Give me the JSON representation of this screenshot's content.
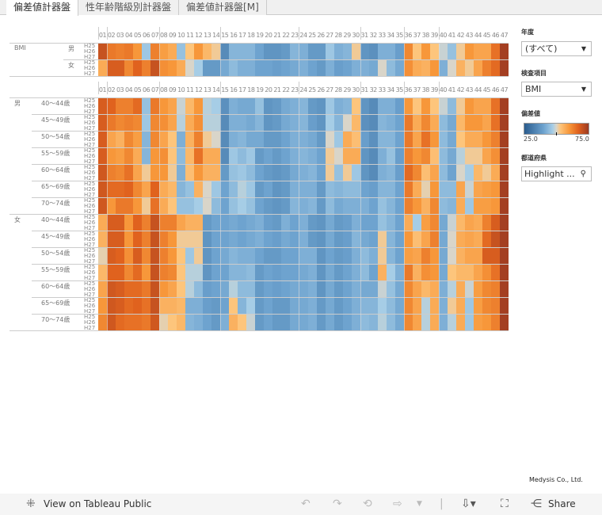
{
  "tabs": [
    "偏差値計器盤",
    "性年齢階級別計器盤",
    "偏差値計器盤[M]"
  ],
  "columns": [
    "01",
    "02",
    "03",
    "04",
    "05",
    "06",
    "07",
    "08",
    "09",
    "10",
    "11",
    "12",
    "13",
    "14",
    "15",
    "16",
    "17",
    "18",
    "19",
    "20",
    "21",
    "22",
    "23",
    "24",
    "25",
    "26",
    "27",
    "28",
    "29",
    "30",
    "31",
    "32",
    "33",
    "34",
    "35",
    "36",
    "37",
    "38",
    "39",
    "40",
    "41",
    "42",
    "43",
    "44",
    "45",
    "46",
    "47"
  ],
  "years": [
    "H25",
    "H26",
    "H27"
  ],
  "top_section": {
    "item": "BMI",
    "groups": [
      {
        "sex": "男",
        "values": [
          70,
          64,
          63,
          64,
          60,
          46,
          63,
          59,
          57,
          45,
          53,
          60,
          55,
          52,
          35,
          43,
          43,
          43,
          40,
          37,
          37,
          38,
          43,
          42,
          38,
          38,
          46,
          42,
          43,
          52,
          37,
          36,
          42,
          42,
          39,
          62,
          53,
          60,
          53,
          49,
          45,
          52,
          60,
          58,
          58,
          65,
          74
        ]
      },
      {
        "sex": "女",
        "values": [
          57,
          68,
          68,
          62,
          67,
          63,
          70,
          61,
          60,
          57,
          50,
          47,
          38,
          38,
          41,
          44,
          42,
          42,
          40,
          40,
          39,
          40,
          41,
          42,
          40,
          38,
          42,
          39,
          40,
          42,
          42,
          41,
          50,
          44,
          41,
          61,
          57,
          56,
          60,
          42,
          50,
          56,
          52,
          58,
          63,
          66,
          74
        ]
      }
    ]
  },
  "bottom_section": [
    {
      "sex": "男",
      "groups": [
        {
          "age": "40～44歳",
          "values": [
            68,
            67,
            63,
            63,
            66,
            45,
            64,
            60,
            58,
            49,
            55,
            60,
            48,
            47,
            36,
            42,
            41,
            41,
            45,
            37,
            38,
            41,
            42,
            43,
            38,
            37,
            46,
            42,
            43,
            53,
            37,
            35,
            42,
            42,
            39,
            60,
            53,
            60,
            53,
            49,
            44,
            52,
            60,
            58,
            58,
            65,
            74
          ]
        },
        {
          "age": "45～49歳",
          "values": [
            68,
            64,
            62,
            63,
            62,
            46,
            62,
            61,
            58,
            48,
            57,
            61,
            48,
            48,
            35,
            42,
            42,
            41,
            43,
            37,
            38,
            41,
            42,
            43,
            39,
            37,
            47,
            43,
            50,
            55,
            36,
            35,
            43,
            42,
            40,
            64,
            57,
            62,
            57,
            44,
            41,
            55,
            60,
            60,
            58,
            65,
            74
          ]
        },
        {
          "age": "50～54歳",
          "values": [
            68,
            58,
            56,
            62,
            59,
            43,
            62,
            58,
            53,
            42,
            56,
            63,
            52,
            50,
            35,
            42,
            43,
            41,
            41,
            38,
            38,
            40,
            42,
            42,
            41,
            38,
            50,
            46,
            57,
            54,
            39,
            36,
            43,
            43,
            40,
            64,
            58,
            65,
            60,
            44,
            41,
            53,
            57,
            57,
            60,
            63,
            74
          ]
        },
        {
          "age": "55～59歳",
          "values": [
            68,
            60,
            59,
            62,
            57,
            43,
            60,
            61,
            53,
            44,
            55,
            65,
            57,
            57,
            35,
            46,
            44,
            46,
            38,
            40,
            38,
            40,
            42,
            43,
            42,
            40,
            52,
            50,
            57,
            57,
            37,
            35,
            42,
            45,
            39,
            63,
            60,
            62,
            54,
            44,
            41,
            48,
            52,
            52,
            58,
            61,
            74
          ]
        },
        {
          "age": "60～64歳",
          "values": [
            69,
            63,
            62,
            65,
            58,
            52,
            60,
            60,
            52,
            42,
            54,
            60,
            56,
            56,
            38,
            45,
            46,
            44,
            40,
            38,
            37,
            38,
            41,
            42,
            43,
            40,
            52,
            45,
            52,
            46,
            37,
            35,
            42,
            43,
            39,
            66,
            62,
            54,
            58,
            44,
            40,
            50,
            47,
            55,
            52,
            57,
            74
          ]
        },
        {
          "age": "65～69歳",
          "values": [
            69,
            66,
            66,
            67,
            62,
            58,
            67,
            57,
            55,
            43,
            45,
            56,
            50,
            46,
            40,
            44,
            48,
            46,
            38,
            40,
            37,
            38,
            42,
            42,
            42,
            38,
            44,
            43,
            44,
            44,
            40,
            39,
            43,
            43,
            40,
            64,
            57,
            51,
            60,
            44,
            44,
            58,
            49,
            58,
            59,
            60,
            74
          ]
        },
        {
          "age": "70～74歳",
          "values": [
            69,
            60,
            64,
            64,
            60,
            52,
            65,
            57,
            53,
            45,
            45,
            47,
            50,
            44,
            40,
            45,
            47,
            45,
            40,
            38,
            37,
            38,
            43,
            42,
            43,
            38,
            44,
            41,
            42,
            42,
            42,
            40,
            45,
            43,
            40,
            63,
            60,
            56,
            62,
            44,
            43,
            57,
            46,
            59,
            59,
            60,
            74
          ]
        }
      ]
    },
    {
      "sex": "女",
      "groups": [
        {
          "age": "40～44歳",
          "values": [
            57,
            68,
            68,
            60,
            67,
            63,
            70,
            63,
            63,
            58,
            56,
            56,
            38,
            40,
            40,
            41,
            40,
            41,
            42,
            39,
            38,
            42,
            40,
            42,
            38,
            37,
            41,
            38,
            39,
            42,
            40,
            40,
            45,
            43,
            40,
            57,
            47,
            59,
            62,
            41,
            49,
            55,
            58,
            57,
            63,
            68,
            74
          ]
        },
        {
          "age": "45～49歳",
          "values": [
            56,
            68,
            68,
            60,
            67,
            63,
            70,
            63,
            60,
            52,
            52,
            52,
            37,
            40,
            40,
            41,
            40,
            41,
            42,
            40,
            39,
            41,
            40,
            42,
            38,
            37,
            41,
            38,
            39,
            43,
            41,
            40,
            52,
            43,
            40,
            60,
            54,
            58,
            63,
            41,
            50,
            57,
            58,
            57,
            66,
            70,
            74
          ]
        },
        {
          "age": "50～54歳",
          "values": [
            51,
            68,
            67,
            61,
            68,
            62,
            70,
            63,
            60,
            53,
            46,
            52,
            37,
            40,
            41,
            43,
            42,
            42,
            40,
            38,
            38,
            40,
            40,
            42,
            42,
            37,
            40,
            38,
            39,
            42,
            44,
            42,
            52,
            43,
            40,
            59,
            58,
            63,
            60,
            41,
            50,
            56,
            58,
            58,
            68,
            68,
            74
          ]
        },
        {
          "age": "55～59歳",
          "values": [
            55,
            67,
            67,
            62,
            66,
            60,
            70,
            63,
            62,
            53,
            48,
            48,
            37,
            40,
            40,
            43,
            43,
            44,
            38,
            40,
            39,
            40,
            40,
            41,
            42,
            37,
            41,
            38,
            40,
            42,
            44,
            40,
            56,
            47,
            42,
            64,
            56,
            61,
            60,
            41,
            53,
            55,
            55,
            58,
            61,
            65,
            74
          ]
        },
        {
          "age": "60～64歳",
          "values": [
            58,
            69,
            68,
            66,
            66,
            64,
            70,
            60,
            58,
            53,
            48,
            44,
            39,
            40,
            41,
            48,
            44,
            44,
            38,
            40,
            39,
            40,
            41,
            41,
            42,
            37,
            41,
            38,
            40,
            42,
            41,
            41,
            49,
            45,
            41,
            62,
            58,
            55,
            57,
            42,
            48,
            57,
            49,
            59,
            62,
            63,
            74
          ]
        },
        {
          "age": "65～69歳",
          "values": [
            60,
            69,
            68,
            66,
            67,
            65,
            70,
            56,
            56,
            55,
            42,
            42,
            39,
            38,
            40,
            53,
            43,
            47,
            38,
            40,
            38,
            38,
            41,
            41,
            42,
            38,
            41,
            38,
            40,
            42,
            43,
            43,
            47,
            44,
            41,
            62,
            58,
            48,
            57,
            42,
            52,
            57,
            46,
            59,
            62,
            63,
            74
          ]
        },
        {
          "age": "70～74歳",
          "values": [
            62,
            69,
            66,
            65,
            65,
            64,
            69,
            51,
            53,
            55,
            43,
            42,
            40,
            38,
            42,
            56,
            53,
            49,
            38,
            40,
            38,
            38,
            41,
            41,
            42,
            38,
            41,
            38,
            40,
            42,
            44,
            43,
            48,
            44,
            41,
            62,
            58,
            48,
            57,
            42,
            48,
            57,
            46,
            59,
            60,
            63,
            74
          ]
        }
      ]
    }
  ],
  "color_scale": {
    "min": 25,
    "max": 75,
    "stops": [
      "#2a5c8e",
      "#6ea3cf",
      "#a6cde6",
      "#d9d5c9",
      "#fdc57c",
      "#f7973a",
      "#e0621e",
      "#9b3a22"
    ]
  },
  "filters": {
    "year": {
      "title": "年度",
      "value": "(すべて)"
    },
    "item": {
      "title": "検査項目",
      "value": "BMI"
    },
    "legend": {
      "title": "偏差値",
      "min_label": "25.0",
      "max_label": "75.0"
    },
    "prefecture": {
      "title": "都道府県",
      "placeholder": "Highlight ..."
    }
  },
  "credit": "Medysis Co., Ltd.",
  "footer": {
    "view_label": "View on Tableau Public",
    "share_label": "Share"
  }
}
